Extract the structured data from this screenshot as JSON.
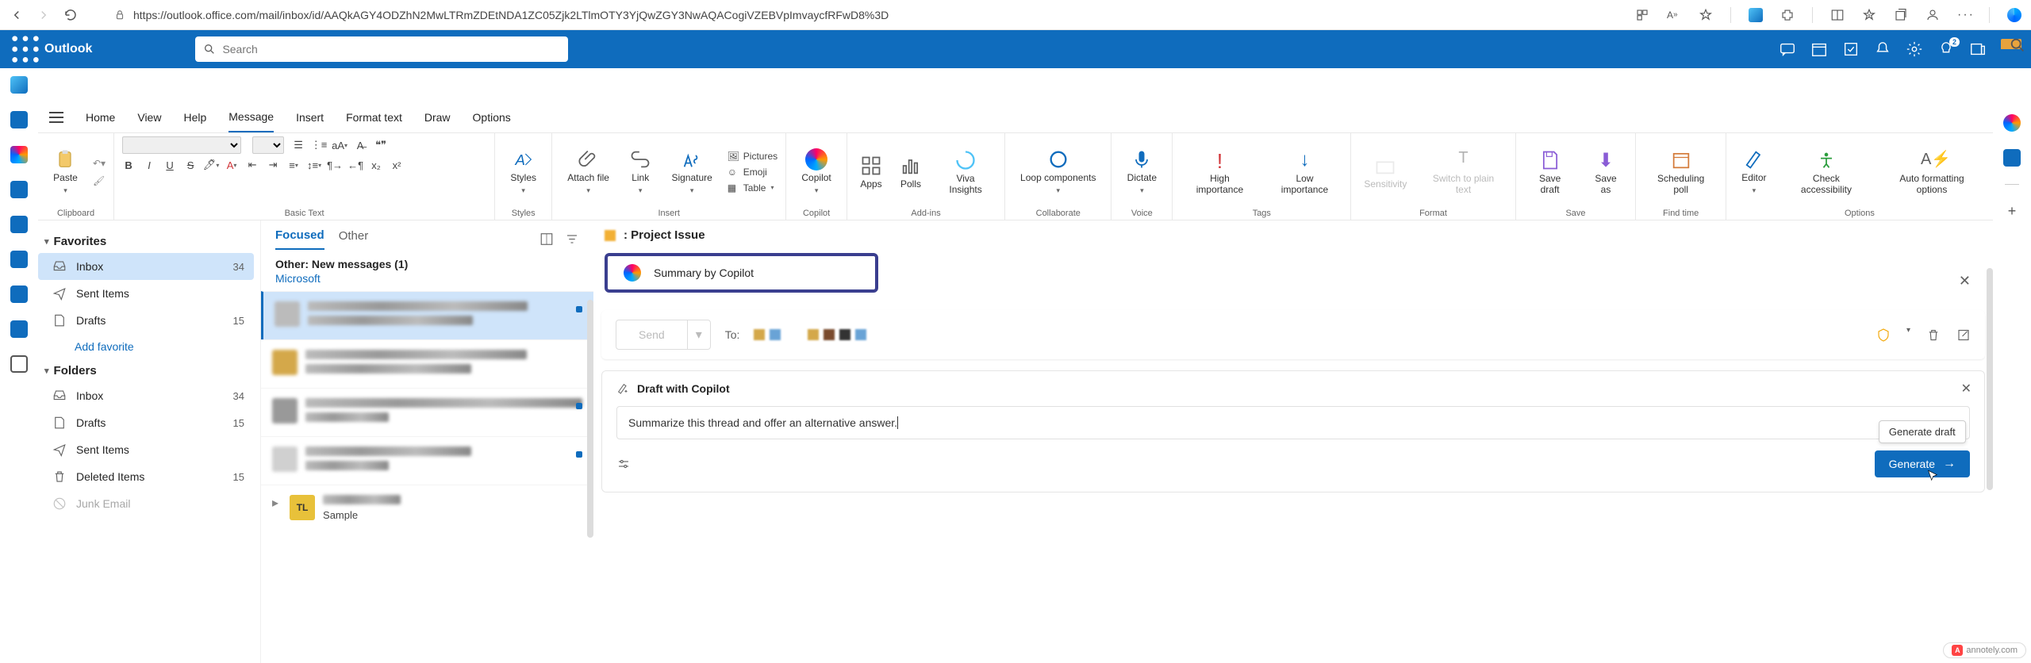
{
  "browser": {
    "url": "https://outlook.office.com/mail/inbox/id/AAQkAGY4ODZhN2MwLTRmZDEtNDA1ZC05Zjk2LTlmOTY3YjQwZGY3NwAQACogiVZEBVpImvaycfRFwD8%3D"
  },
  "header": {
    "brand": "Outlook",
    "search_placeholder": "Search",
    "notif_badge": "2"
  },
  "tabs": [
    "Home",
    "View",
    "Help",
    "Message",
    "Insert",
    "Format text",
    "Draw",
    "Options"
  ],
  "active_tab": "Message",
  "ribbon": {
    "clipboard": {
      "paste": "Paste",
      "label": "Clipboard"
    },
    "basic_text": {
      "label": "Basic Text",
      "format_painter": ""
    },
    "styles": {
      "styles": "Styles",
      "label": "Styles"
    },
    "insert": {
      "attach": "Attach file",
      "link": "Link",
      "signature": "Signature",
      "pictures": "Pictures",
      "emoji": "Emoji",
      "table": "Table",
      "label": "Insert"
    },
    "copilot": {
      "copilot": "Copilot",
      "label": "Copilot"
    },
    "addins": {
      "apps": "Apps",
      "polls": "Polls",
      "viva": "Viva Insights",
      "label": "Add-ins"
    },
    "collaborate": {
      "loop": "Loop components",
      "label": "Collaborate"
    },
    "voice": {
      "dictate": "Dictate",
      "label": "Voice"
    },
    "tags": {
      "high": "High importance",
      "low": "Low importance",
      "label": "Tags"
    },
    "sensitivity": {
      "sens": "Sensitivity",
      "plain": "Switch to plain text",
      "label": ""
    },
    "format": {
      "label": "Format"
    },
    "save": {
      "draft": "Save draft",
      "as": "Save as",
      "label": "Save"
    },
    "findtime": {
      "poll": "Scheduling poll",
      "label": "Find time"
    },
    "options": {
      "editor": "Editor",
      "check": "Check accessibility",
      "auto": "Auto formatting options",
      "label": "Options"
    }
  },
  "sections": {
    "favorites": "Favorites",
    "folders": "Folders"
  },
  "fav_items": [
    {
      "label": "Inbox",
      "count": "34",
      "icon": "inbox",
      "selected": true
    },
    {
      "label": "Sent Items",
      "count": "",
      "icon": "sent"
    },
    {
      "label": "Drafts",
      "count": "15",
      "icon": "draft"
    }
  ],
  "add_favorite": "Add favorite",
  "folder_items": [
    {
      "label": "Inbox",
      "count": "34",
      "icon": "inbox"
    },
    {
      "label": "Drafts",
      "count": "15",
      "icon": "draft"
    },
    {
      "label": "Sent Items",
      "count": "",
      "icon": "sent"
    },
    {
      "label": "Deleted Items",
      "count": "15",
      "icon": "trash"
    },
    {
      "label": "Junk Email",
      "count": "",
      "icon": "junk"
    }
  ],
  "msglist": {
    "focused": "Focused",
    "other": "Other",
    "other_head": "Other: New messages (1)",
    "other_sub": "Microsoft",
    "sample": "Sample"
  },
  "pane": {
    "subject": ": Project Issue",
    "summary": "Summary by Copilot",
    "send": "Send",
    "to": "To:",
    "draft_title": "Draft with Copilot",
    "draft_text": "Summarize this thread and offer an alternative answer.",
    "tooltip": "Generate draft",
    "generate": "Generate"
  },
  "annotely": "annotely.com"
}
